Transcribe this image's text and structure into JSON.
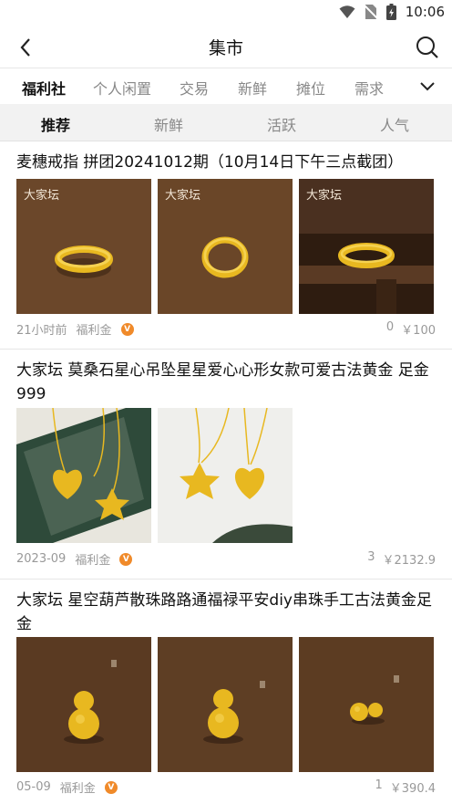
{
  "status": {
    "time": "10:06",
    "icons": [
      "wifi-icon",
      "no-sim-icon",
      "battery-icon"
    ]
  },
  "nav": {
    "title": "集市",
    "back_icon": "chevron-left-icon",
    "search_icon": "search-icon"
  },
  "categories": [
    "福利社",
    "个人闲置",
    "交易",
    "新鲜",
    "摊位",
    "需求"
  ],
  "sort_tabs": [
    "推荐",
    "新鲜",
    "活跃",
    "人气"
  ],
  "posts": [
    {
      "title": "麦穗戒指 拼团20241012期（10月14日下午三点截团）",
      "time": "21小时前",
      "tag": "福利金",
      "comments": "0",
      "price": "￥100",
      "watermark": "大家坛"
    },
    {
      "title": "大家坛 莫桑石星心吊坠星星爱心心形女款可爱古法黄金 足金999",
      "time": "2023-09",
      "tag": "福利金",
      "comments": "3",
      "price": "￥2132.9"
    },
    {
      "title": "大家坛 星空葫芦散珠路路通福禄平安diy串珠手工古法黄金足金",
      "time": "05-09",
      "tag": "福利金",
      "comments": "1",
      "price": "￥390.4"
    }
  ],
  "colors": {
    "accent_badge": "#f08a2a",
    "tab_bg": "#f2f2f2",
    "gold": "#e8b820"
  }
}
